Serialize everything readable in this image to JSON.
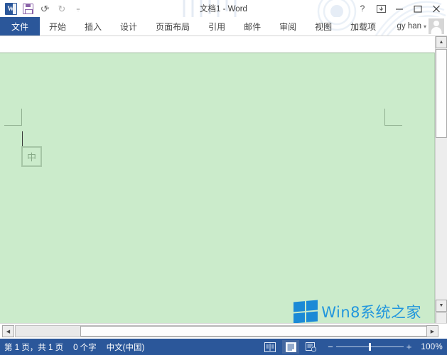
{
  "window": {
    "title": "文档1 - Word",
    "quick_access": [
      {
        "name": "word-app-icon",
        "label": "W"
      },
      {
        "name": "save-icon",
        "label": "保存"
      },
      {
        "name": "undo-icon",
        "label": "撤消"
      },
      {
        "name": "redo-icon",
        "label": "恢复"
      },
      {
        "name": "customize-qat-icon",
        "label": "自定义快速访问工具栏"
      }
    ],
    "controls": {
      "help": "?",
      "ribbon_display": "功能区显示选项",
      "minimize": "最小化",
      "restore": "向下还原",
      "close": "关闭"
    }
  },
  "ribbon": {
    "tabs": [
      {
        "label": "文件",
        "active": true
      },
      {
        "label": "开始",
        "active": false
      },
      {
        "label": "插入",
        "active": false
      },
      {
        "label": "设计",
        "active": false
      },
      {
        "label": "页面布局",
        "active": false
      },
      {
        "label": "引用",
        "active": false
      },
      {
        "label": "邮件",
        "active": false
      },
      {
        "label": "审阅",
        "active": false
      },
      {
        "label": "视图",
        "active": false
      },
      {
        "label": "加载项",
        "active": false
      }
    ],
    "account": {
      "name": "gy han",
      "caret": "▾"
    }
  },
  "document": {
    "page_background": "#cbebcb",
    "ime_indicator": "中",
    "watermark_text": "Win8系统之家",
    "watermark_color": "#2196dd"
  },
  "scrollbars": {
    "vertical": {
      "up": "▲",
      "down": "▼"
    },
    "horizontal": {
      "left": "◀",
      "right": "▶"
    }
  },
  "statusbar": {
    "page_info": "第 1 页，共 1 页",
    "word_count": "0 个字",
    "language": "中文(中国)",
    "views": [
      {
        "name": "read-mode-view-button",
        "label": "阅读视图",
        "active": false
      },
      {
        "name": "print-layout-view-button",
        "label": "页面视图",
        "active": true
      },
      {
        "name": "web-layout-view-button",
        "label": "Web 版式视图",
        "active": false
      }
    ],
    "zoom": {
      "minus": "−",
      "plus": "+",
      "level": "100%"
    }
  }
}
